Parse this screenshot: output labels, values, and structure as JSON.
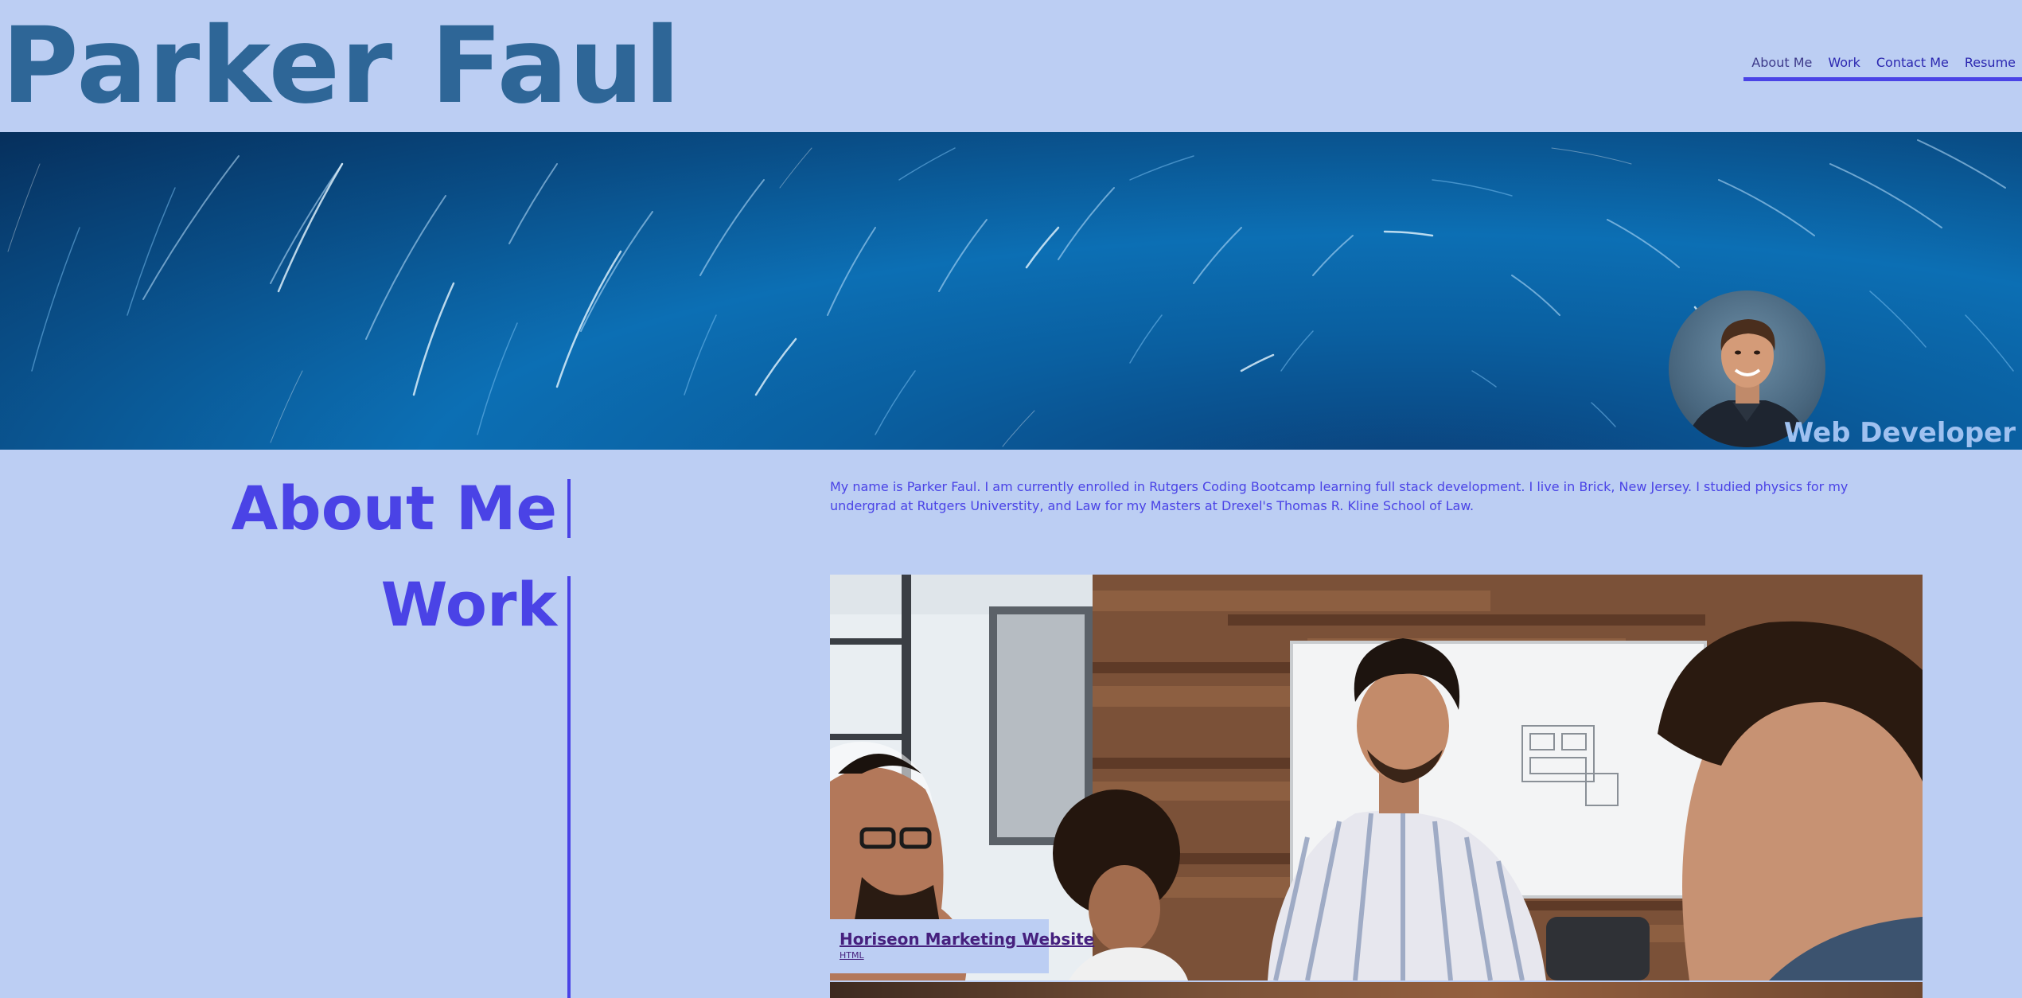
{
  "header": {
    "title": "Parker Faul",
    "nav": [
      {
        "label": "About Me"
      },
      {
        "label": "Work"
      },
      {
        "label": "Contact Me"
      },
      {
        "label": "Resume"
      }
    ]
  },
  "hero": {
    "subtitle": "Web Developer"
  },
  "about": {
    "heading": "About Me",
    "text": "My name is Parker Faul. I am currently enrolled in Rutgers Coding Bootcamp learning full stack development. I live in Brick, New Jersey. I studied physics for my undergrad at Rutgers Universtity, and Law for my Masters at Drexel's Thomas R. Kline School of Law."
  },
  "work": {
    "heading": "Work",
    "projects": [
      {
        "title": "Horiseon Marketing Website",
        "tag": "HTML"
      }
    ]
  },
  "colors": {
    "background": "#bccef3",
    "title": "#2e6697",
    "accent": "#4a43e6",
    "link": "#46207e"
  }
}
